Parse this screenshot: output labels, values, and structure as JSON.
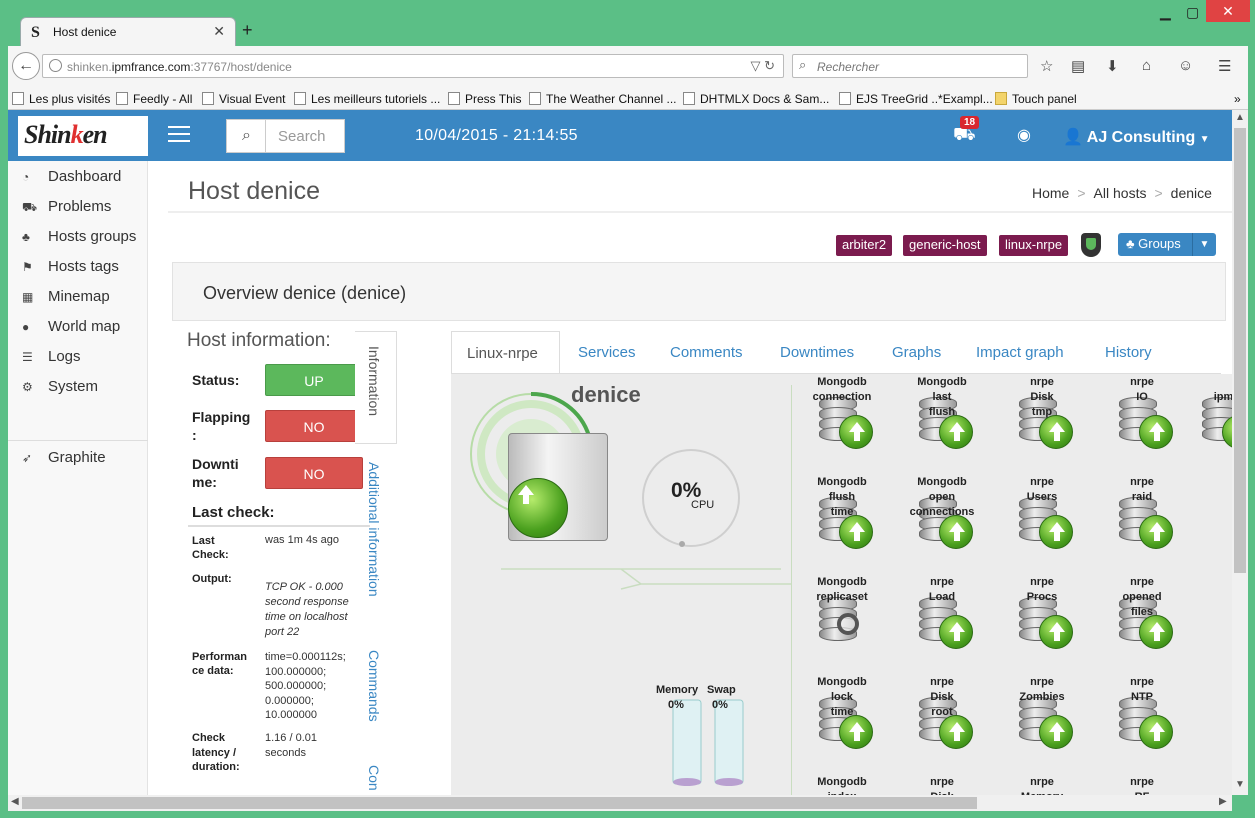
{
  "browser": {
    "tab_title": "Host denice",
    "url_host": "shinken.",
    "url_domain": "ipmfrance.com",
    "url_path": ":37767/host/denice",
    "search_placeholder": "Rechercher",
    "bookmarks": [
      "Les plus visités",
      "Feedly - All",
      "Visual Event",
      "Les meilleurs tutoriels ...",
      "Press This",
      "The Weather Channel ...",
      "DHTMLX Docs & Sam...",
      "EJS TreeGrid ..*Exampl...",
      "Touch panel"
    ]
  },
  "header": {
    "logo_main": "Shin",
    "logo_accent": "k",
    "logo_end": "en",
    "search_placeholder": "Search",
    "datetime": "10/04/2015 - 21:14:55",
    "notification_count": "18",
    "user": "AJ Consulting"
  },
  "sidebar": {
    "items": [
      {
        "label": "Dashboard",
        "icon": "tachometer-icon"
      },
      {
        "label": "Problems",
        "icon": "ambulance-icon"
      },
      {
        "label": "Hosts groups",
        "icon": "sitemap-icon"
      },
      {
        "label": "Hosts tags",
        "icon": "tags-icon"
      },
      {
        "label": "Minemap",
        "icon": "table-icon"
      },
      {
        "label": "World map",
        "icon": "globe-icon"
      },
      {
        "label": "Logs",
        "icon": "list-icon"
      },
      {
        "label": "System",
        "icon": "gears-icon"
      },
      {
        "label": "Graphite",
        "icon": "rocket-icon"
      }
    ]
  },
  "page": {
    "title": "Host denice",
    "breadcrumb": [
      "Home",
      "All hosts",
      "denice"
    ],
    "tags": [
      "arbiter2",
      "generic-host",
      "linux-nrpe"
    ],
    "groups_label": "Groups",
    "overview": "Overview denice (denice)"
  },
  "host_info": {
    "heading": "Host information:",
    "status_label": "Status:",
    "status_value": "UP",
    "flapping_label": "Flapping",
    "flapping_label2": ":",
    "flapping_value": "NO",
    "downtime_label": "Downti",
    "downtime_label2": "me:",
    "downtime_value": "NO",
    "last_check_heading": "Last check:",
    "details": {
      "last_check_k1": "Last",
      "last_check_k2": "Check:",
      "last_check_v": "was 1m 4s ago",
      "output_k": "Output:",
      "output_v": [
        "TCP OK - 0.000",
        "second response",
        "time on localhost",
        "port 22"
      ],
      "perf_k1": "Performan",
      "perf_k2": "ce data:",
      "perf_v": [
        "time=0.000112s;",
        "100.000000;",
        "500.000000;",
        "0.000000;",
        "10.000000"
      ],
      "lat_k": [
        "Check",
        "latency /",
        "duration:"
      ],
      "lat_v": [
        "1.16 / 0.01",
        "seconds"
      ]
    },
    "vertical_tabs": [
      "Information",
      "Additional information",
      "Commands",
      "Con"
    ]
  },
  "tabs": [
    "Linux-nrpe",
    "Services",
    "Comments",
    "Downtimes",
    "Graphs",
    "Impact graph",
    "History"
  ],
  "impact": {
    "host": "denice",
    "cpu_value": "0%",
    "cpu_label": "CPU",
    "memory_label": "Memory",
    "memory_value": "0%",
    "swap_label": "Swap",
    "swap_value": "0%",
    "services": [
      {
        "l1": "Mongodb",
        "l2": "connection",
        "l3": ""
      },
      {
        "l1": "Mongodb",
        "l2": "last",
        "l3": "flush"
      },
      {
        "l1": "nrpe",
        "l2": "Disk",
        "l3": "tmp"
      },
      {
        "l1": "nrpe",
        "l2": "IO",
        "l3": ""
      },
      {
        "l1": "",
        "l2": "ipmi",
        "l3": ""
      },
      {
        "l1": "Mongodb",
        "l2": "flush",
        "l3": "time"
      },
      {
        "l1": "Mongodb",
        "l2": "open",
        "l3": "connections"
      },
      {
        "l1": "nrpe",
        "l2": "Users",
        "l3": ""
      },
      {
        "l1": "nrpe",
        "l2": "raid",
        "l3": ""
      },
      {
        "l1": "Mongodb",
        "l2": "replicaset",
        "l3": ""
      },
      {
        "l1": "nrpe",
        "l2": "Load",
        "l3": ""
      },
      {
        "l1": "nrpe",
        "l2": "Procs",
        "l3": ""
      },
      {
        "l1": "nrpe",
        "l2": "opened",
        "l3": "files"
      },
      {
        "l1": "Mongodb",
        "l2": "lock",
        "l3": "time"
      },
      {
        "l1": "nrpe",
        "l2": "Disk",
        "l3": "root"
      },
      {
        "l1": "nrpe",
        "l2": "Zombies",
        "l3": ""
      },
      {
        "l1": "nrpe",
        "l2": "NTP",
        "l3": ""
      },
      {
        "l1": "Mongodb",
        "l2": "index",
        "l3": ""
      },
      {
        "l1": "nrpe",
        "l2": "Disk",
        "l3": ""
      },
      {
        "l1": "nrpe",
        "l2": "Memory",
        "l3": ""
      },
      {
        "l1": "nrpe",
        "l2": "RF",
        "l3": ""
      }
    ]
  },
  "colors": {
    "brand": "#3a87c3",
    "up": "#5cb85c",
    "no": "#d9534f",
    "tag": "#7b1b4e"
  }
}
